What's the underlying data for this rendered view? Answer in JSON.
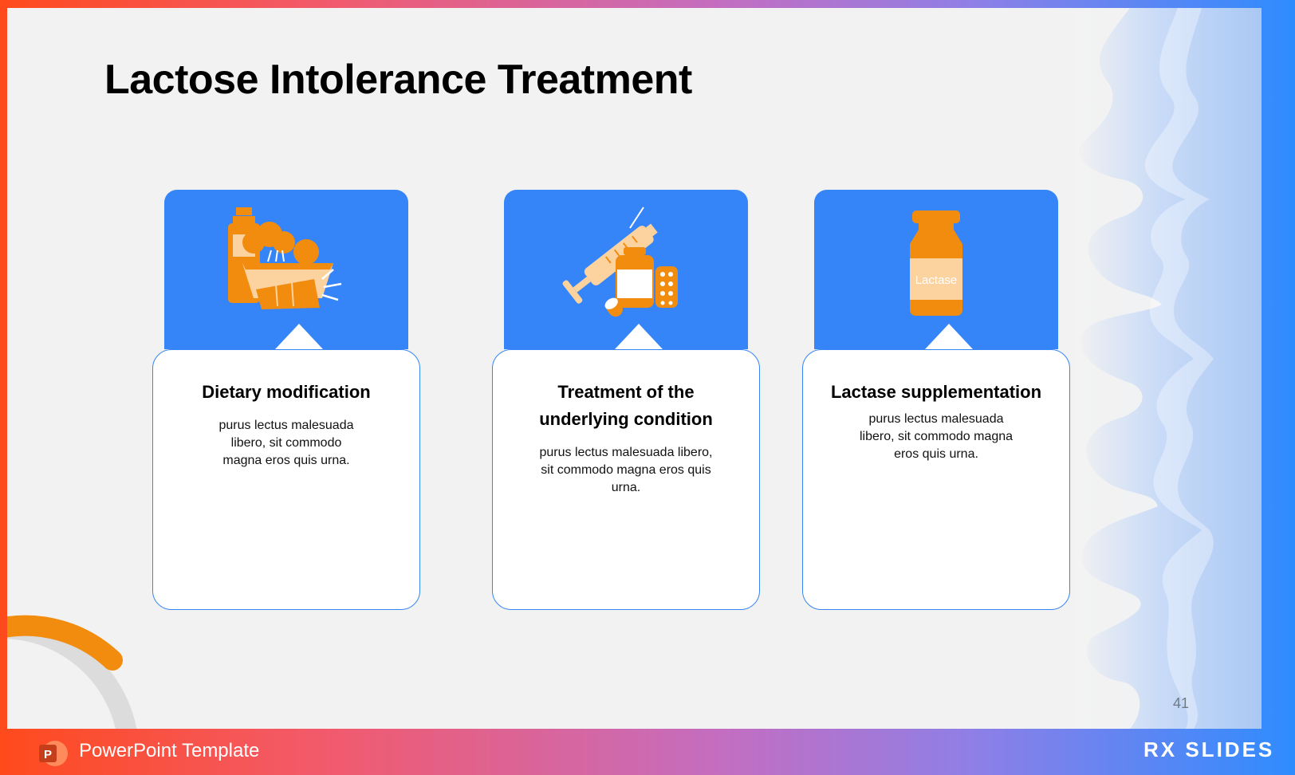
{
  "slide": {
    "title": "Lactose Intolerance Treatment",
    "page_number": "41"
  },
  "cards": [
    {
      "title": "Dietary modification",
      "text": "purus lectus malesuada libero, sit commodo magna eros quis urna.",
      "icon": "food-groceries-icon"
    },
    {
      "title": "Treatment of the underlying condition",
      "text": "purus lectus malesuada libero, sit commodo magna eros quis urna.",
      "icon": "syringe-medicine-icon"
    },
    {
      "title": "Lactase supplementation",
      "text": "purus lectus malesuada libero, sit commodo magna eros quis urna.",
      "icon": "lactase-bottle-icon",
      "bottle_label": "Lactase"
    }
  ],
  "footer": {
    "label": "PowerPoint Template",
    "brand": "RX SLIDES"
  },
  "colors": {
    "accent_blue": "#3585f8",
    "accent_orange": "#f28c0f",
    "background": "#f2f2f2"
  }
}
